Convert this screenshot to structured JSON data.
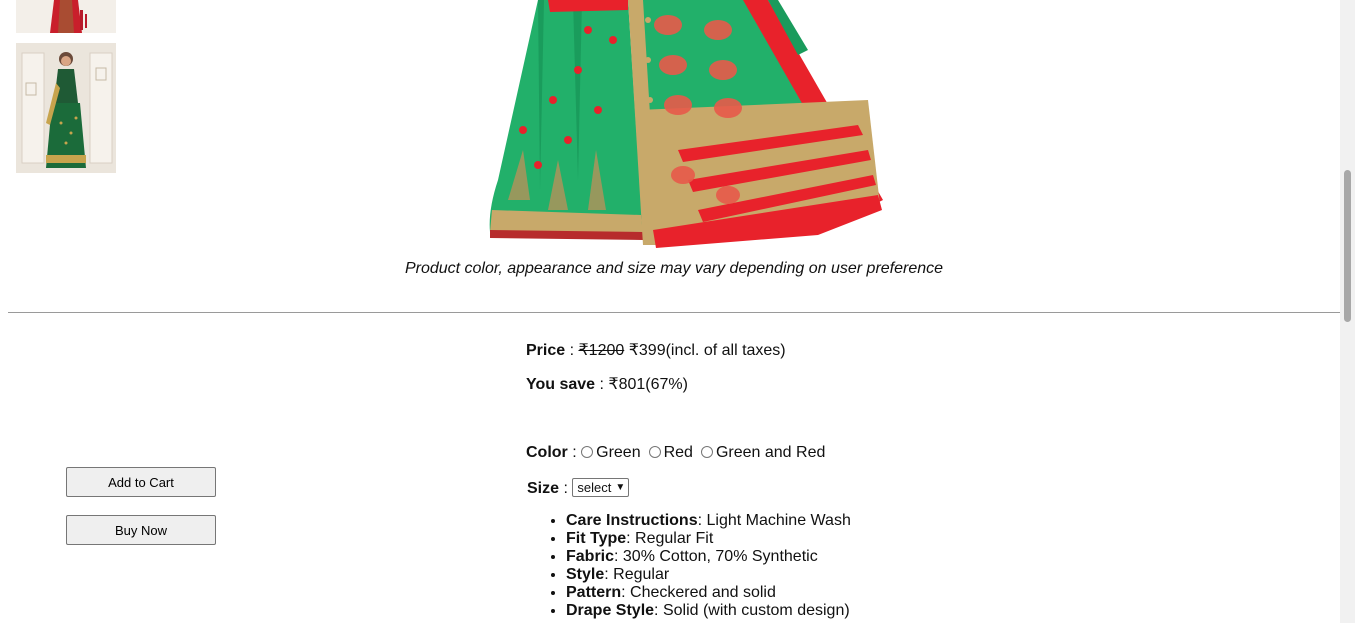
{
  "gallery": {
    "thumbnails": [
      {
        "icon": "saree-thumbnail-red"
      },
      {
        "icon": "saree-thumbnail-green"
      }
    ]
  },
  "hero": {
    "icon": "saree-main-image",
    "colors": {
      "green": "#20b065",
      "red": "#e8222b",
      "gold": "#c8a96a"
    }
  },
  "caption": "Product color, appearance and size may vary depending on user preference",
  "actions": {
    "add_to_cart": "Add to Cart",
    "buy_now": "Buy Now"
  },
  "price": {
    "label": "Price",
    "sep": " : ",
    "original": "₹1200",
    "current": "₹399",
    "note": "(incl. of all taxes)"
  },
  "savings": {
    "label": "You save",
    "sep": " : ",
    "amount": "₹801",
    "percent": "(67%)"
  },
  "color": {
    "label": "Color",
    "sep": " : ",
    "options": [
      "Green",
      "Red",
      "Green and Red"
    ]
  },
  "size": {
    "label": "Size",
    "sep": " : ",
    "selected": "select"
  },
  "specs": [
    {
      "key": "Care Instructions",
      "value": ": Light Machine Wash"
    },
    {
      "key": "Fit Type",
      "value": ": Regular Fit"
    },
    {
      "key": "Fabric",
      "value": ": 30% Cotton, 70% Synthetic"
    },
    {
      "key": "Style",
      "value": ": Regular"
    },
    {
      "key": "Pattern",
      "value": ": Checkered and solid"
    },
    {
      "key": "Drape Style",
      "value": ": Solid (with custom design)"
    }
  ]
}
